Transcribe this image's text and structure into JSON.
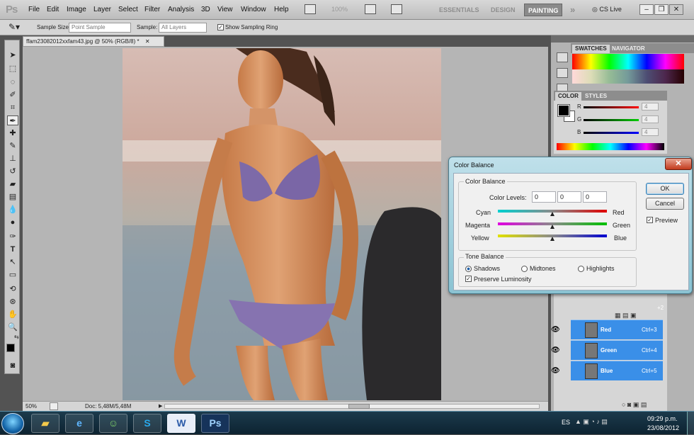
{
  "app": {
    "logo": "Ps"
  },
  "menu": [
    "File",
    "Edit",
    "Image",
    "Layer",
    "Select",
    "Filter",
    "Analysis",
    "3D",
    "View",
    "Window",
    "Help"
  ],
  "zoom_menu": "100%",
  "workspaces": {
    "essentials": "ESSENTIALS",
    "design": "DESIGN",
    "painting": "PAINTING",
    "more": "»",
    "cs_live": "CS Live"
  },
  "window_buttons": {
    "minimize": "–",
    "restore": "❐",
    "close": "✕"
  },
  "options": {
    "sample_size_label": "Sample Size:",
    "sample_size_value": "Point Sample",
    "sample_label": "Sample:",
    "sample_value": "All Layers",
    "ring_label": "Show Sampling Ring",
    "ring_checked": true
  },
  "document": {
    "tab_title": "ffam23082012xxfam43.jpg @ 50% (RGB/8) *",
    "tab_close": "✕"
  },
  "status": {
    "zoom": "50%",
    "doc": "Doc: 5,48M/5,48M"
  },
  "panels": {
    "swatches_tab": "SWATCHES",
    "navigator_tab": "NAVIGATOR",
    "color_tab": "COLOR",
    "styles_tab": "STYLES",
    "r_label": "R",
    "g_label": "G",
    "b_label": "B",
    "r_value": "4",
    "g_value": "4",
    "b_value": "4"
  },
  "channels": [
    {
      "name": "Red",
      "shortcut": "Ctrl+3"
    },
    {
      "name": "Green",
      "shortcut": "Ctrl+4"
    },
    {
      "name": "Blue",
      "shortcut": "Ctrl+5"
    }
  ],
  "channels_partial_shortcut": "+2",
  "dialog": {
    "title": "Color Balance",
    "close": "✕",
    "color_balance_group": "Color Balance",
    "color_levels_label": "Color Levels:",
    "levels": [
      "0",
      "0",
      "0"
    ],
    "sliders": [
      {
        "left": "Cyan",
        "right": "Red",
        "value": 0
      },
      {
        "left": "Magenta",
        "right": "Green",
        "value": 0
      },
      {
        "left": "Yellow",
        "right": "Blue",
        "value": 0
      }
    ],
    "tone_group": "Tone Balance",
    "tones": [
      "Shadows",
      "Midtones",
      "Highlights"
    ],
    "tone_selected": "Shadows",
    "preserve_label": "Preserve Luminosity",
    "preserve_checked": true,
    "ok": "OK",
    "cancel": "Cancel",
    "preview_label": "Preview",
    "preview_checked": true
  },
  "taskbar": {
    "apps": [
      "explorer-icon",
      "ie-icon",
      "messenger-icon",
      "skype-icon",
      "word-icon",
      "photoshop-icon"
    ],
    "skype_label": "S",
    "word_label": "W",
    "ps_label": "Ps",
    "lang": "ES",
    "time": "09:29 p.m.",
    "date": "23/08/2012"
  },
  "colors": {
    "accent_blue": "#3a8fe8",
    "menubar": "#c9c9c9",
    "dialog_glass": "#9ccfdc"
  }
}
